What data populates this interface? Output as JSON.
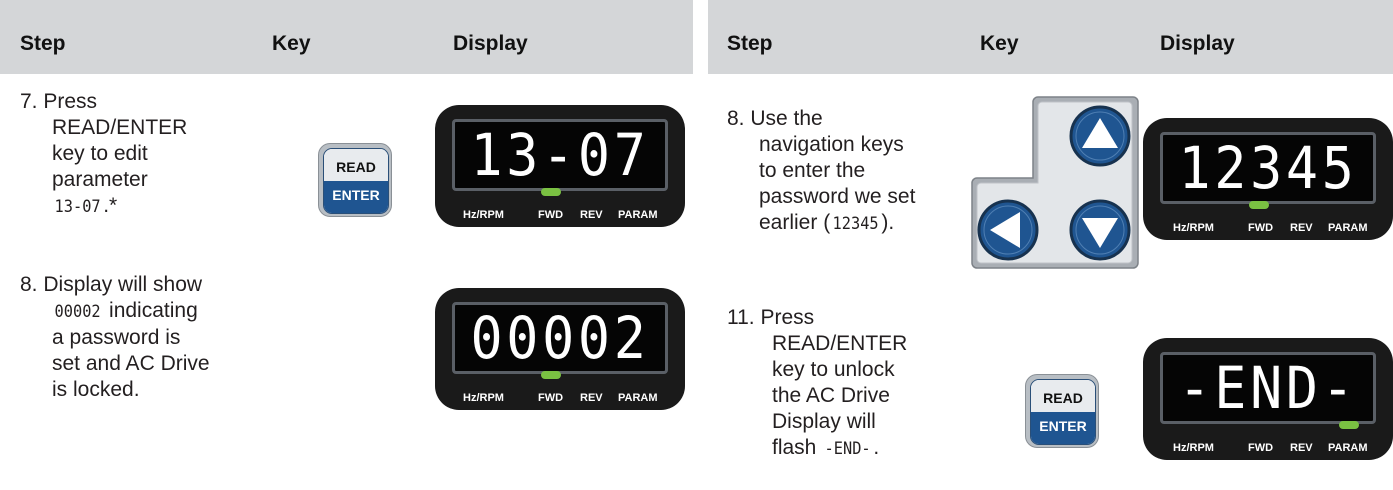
{
  "header": {
    "left": {
      "step": "Step",
      "key": "Key",
      "display": "Display"
    },
    "right": {
      "step": "Step",
      "key": "Key",
      "display": "Display"
    }
  },
  "steps": {
    "s7": {
      "num": "7.",
      "lines": [
        "Press",
        "READ/ENTER",
        "key to edit",
        "parameter"
      ],
      "code": "13-07",
      "suffix": ".*"
    },
    "s8a": {
      "num": "8.",
      "line1": "Display will show",
      "code": "00002",
      "line2": "indicating",
      "lines": [
        "a password is",
        "set and AC Drive",
        "is locked."
      ]
    },
    "s8b": {
      "num": "8.",
      "lines": [
        "Use the",
        "navigation keys",
        "to enter the",
        "password we set"
      ],
      "last_pre": "earlier (",
      "code": "12345",
      "last_post": ")."
    },
    "s11": {
      "num": "11.",
      "lines": [
        "Press",
        "READ/ENTER",
        "key to unlock",
        "the AC Drive",
        "Display will"
      ],
      "last_pre": "flash ",
      "code": "-END-",
      "last_post": "."
    }
  },
  "keys": {
    "read": "READ",
    "enter": "ENTER"
  },
  "displays": {
    "d1": {
      "digits": "13-07",
      "active": "FWD"
    },
    "d2": {
      "digits": "00002",
      "active": "FWD"
    },
    "d3": {
      "digits": "12345",
      "active": "FWD"
    },
    "d4": {
      "digits": "-END-",
      "active": "PARAM"
    }
  },
  "display_labels": {
    "hz": "Hz/RPM",
    "fwd": "FWD",
    "rev": "REV",
    "param": "PARAM"
  },
  "colors": {
    "header_bg": "#d4d6d8",
    "key_blue": "#1f5591",
    "led_green": "#7ac142",
    "nav_blue": "#1f5591"
  },
  "icons": {
    "up": "up-arrow-icon",
    "left": "left-arrow-icon",
    "down": "down-arrow-icon"
  }
}
